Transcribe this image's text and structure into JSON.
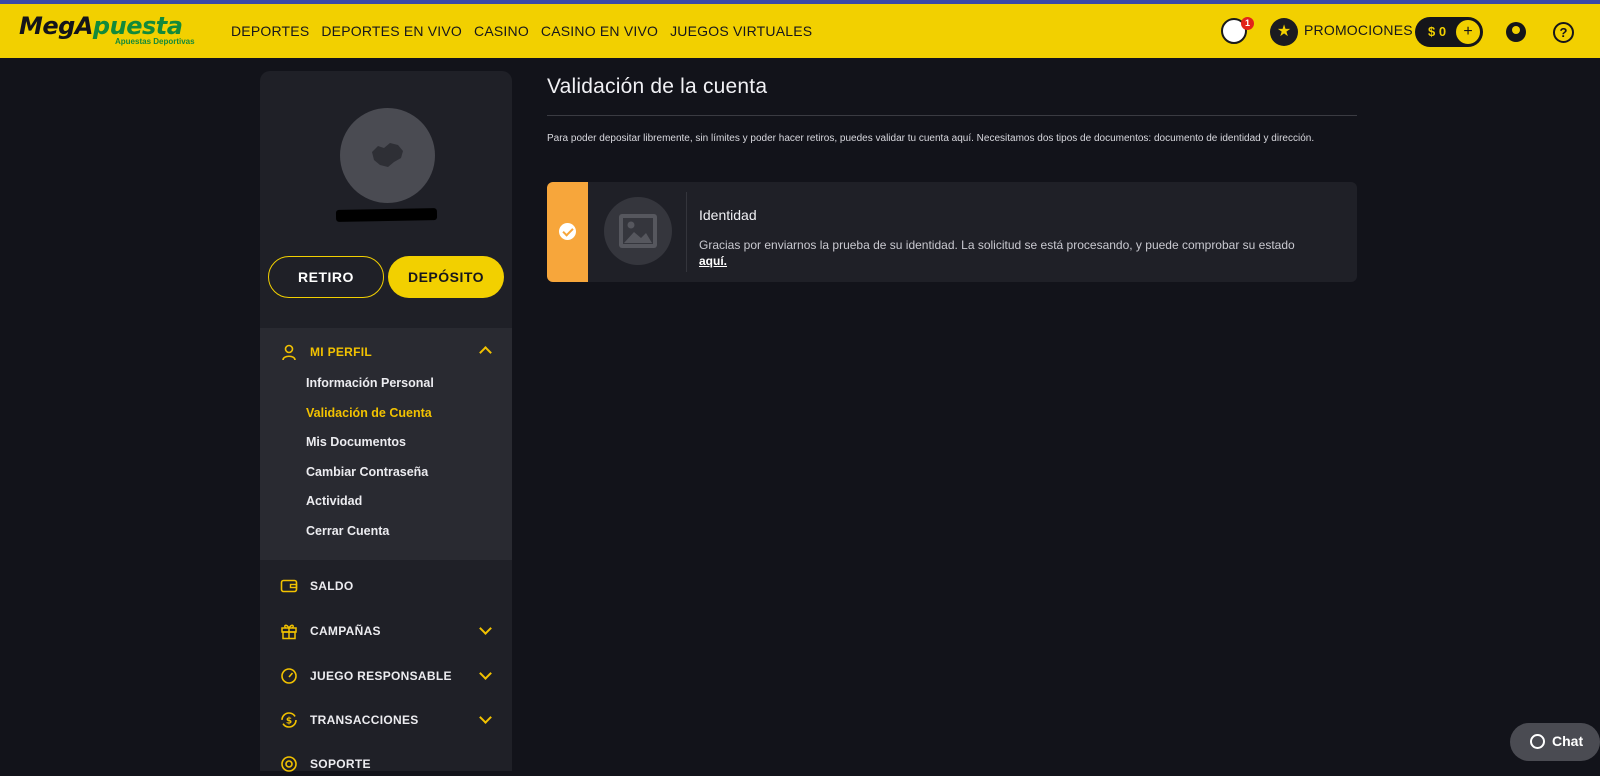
{
  "brand": {
    "logo_main_a": "Meg",
    "logo_main_b": "A",
    "logo_main_c": "puesta",
    "logo_sub": "Apuestas Deportivas"
  },
  "nav": [
    "DEPORTES",
    "DEPORTES EN VIVO",
    "CASINO",
    "CASINO EN VIVO",
    "JUEGOS VIRTUALES"
  ],
  "header": {
    "gift_badge": "1",
    "promotions_label": "PROMOCIONES",
    "balance": "$ 0",
    "plus": "+",
    "help": "?"
  },
  "sidebar": {
    "withdraw_label": "RETIRO",
    "deposit_label": "DEPÓSITO",
    "profile_section": "MI PERFIL",
    "profile_items": [
      "Información Personal",
      "Validación de Cuenta",
      "Mis Documentos",
      "Cambiar Contraseña",
      "Actividad",
      "Cerrar Cuenta"
    ],
    "active_item": "Validación de Cuenta",
    "sections": [
      "SALDO",
      "CAMPAÑAS",
      "JUEGO RESPONSABLE",
      "TRANSACCIONES",
      "SOPORTE"
    ]
  },
  "main": {
    "title": "Validación de la cuenta",
    "intro": "Para poder depositar libremente, sin límites y poder hacer retiros, puedes validar tu cuenta aquí. Necesitamos dos tipos de documentos: documento de identidad y dirección.",
    "identity": {
      "title": "Identidad",
      "text": "Gracias por enviarnos la prueba de su identidad. La solicitud se está procesando, y puede comprobar su estado",
      "link": "aquí."
    }
  },
  "chat": {
    "label": "Chat"
  },
  "colors": {
    "brand_yellow": "#f2d000",
    "accent_orange": "#f7a63b",
    "bg": "#12131a",
    "panel": "#1f2027"
  }
}
